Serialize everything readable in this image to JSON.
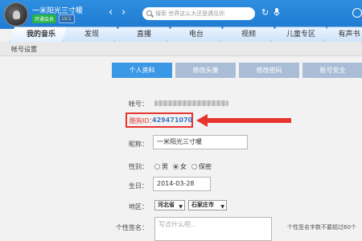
{
  "topbar": {
    "username": "一米阳光三寸暖",
    "badge_green": "开通会员",
    "badge_vip": "LV.1",
    "back_symbol": "‹",
    "forward_symbol": "›",
    "search_placeholder": "搜索 世界这么大还是遇见你",
    "refresh_symbol": "↻",
    "mic_symbol": "🎙"
  },
  "tabs": [
    {
      "label": "我的音乐",
      "active": true
    },
    {
      "label": "发现",
      "active": false
    },
    {
      "label": "直播",
      "active": false
    },
    {
      "label": "电台",
      "active": false
    },
    {
      "label": "视频",
      "active": false
    },
    {
      "label": "儿童专区",
      "active": false
    },
    {
      "label": "有声书",
      "active": false
    }
  ],
  "breadcrumb": "帐号设置",
  "subtabs": [
    {
      "label": "个人资料",
      "active": true
    },
    {
      "label": "修改头像",
      "active": false
    },
    {
      "label": "修改密码",
      "active": false
    },
    {
      "label": "账号安全",
      "active": false
    }
  ],
  "form": {
    "account_label": "帐号：",
    "kugou_id_label": "酷狗ID：",
    "kugou_id_value": "429471070",
    "nickname_label": "昵称：",
    "nickname_value": "一米阳光三寸暖",
    "gender_label": "性别：",
    "gender_options": [
      "男",
      "女",
      "保密"
    ],
    "gender_selected": "女",
    "birthday_label": "生日：",
    "birthday_value": "2014-03-28",
    "region_label": "地区：",
    "province_value": "河北省",
    "city_value": "石家庄市",
    "signature_label": "个性签名：",
    "signature_placeholder": "写点什么吧...",
    "signature_hint": "个性签名字数不要超过60个"
  },
  "colors": {
    "accent": "#3a98e6",
    "highlight": "#e8342f"
  }
}
